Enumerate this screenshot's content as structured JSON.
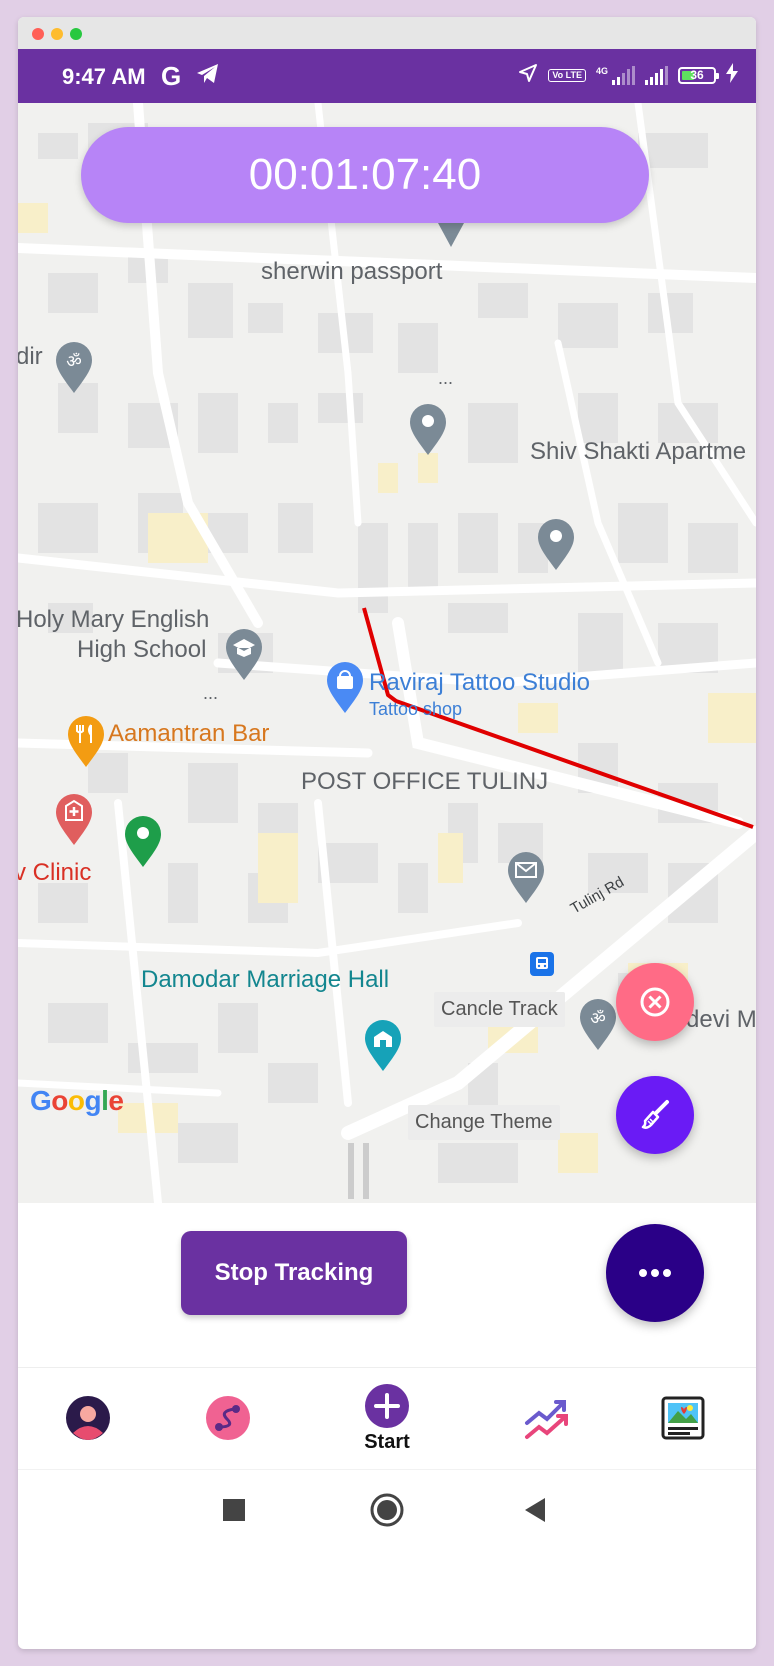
{
  "status_bar": {
    "time": "9:47 AM",
    "g_icon": "G",
    "network": "4G",
    "volte": "Vo LTE",
    "battery": "36"
  },
  "timer": {
    "value": "00:01:07:40"
  },
  "map": {
    "labels": {
      "sherwin": "sherwin passport",
      "dir": "dir",
      "dots1": "...",
      "shiv": "Shiv Shakti Apartme",
      "holy_line1": "Holy Mary English",
      "holy_line2": "High School",
      "dots2": "...",
      "raviraj": "Raviraj Tattoo Studio",
      "raviraj_sub": "Tattoo shop",
      "aamantran": "Aamantran Bar",
      "post_office": "POST OFFICE TULINJ",
      "clinic": "v Clinic",
      "tulinj_rd": "Tulinj Rd",
      "damodar": "Damodar Marriage Hall",
      "devi": "devi M"
    },
    "google": [
      "G",
      "o",
      "o",
      "g",
      "l",
      "e"
    ],
    "google_colors": [
      "#4285F4",
      "#EA4335",
      "#FBBC05",
      "#4285F4",
      "#34A853",
      "#EA4335"
    ]
  },
  "chips": {
    "cancel_track": "Cancle Track",
    "change_theme": "Change Theme"
  },
  "actions": {
    "stop_tracking": "Stop Tracking"
  },
  "bottom_nav": {
    "start_label": "Start",
    "icons": [
      "profile-avatar-icon",
      "route-icon",
      "start-plus-icon",
      "trend-chart-icon",
      "gallery-icon"
    ]
  },
  "colors": {
    "primary": "#6a31a1",
    "timer_bg": "#b784f7",
    "cancel_fab": "#ff6b86",
    "theme_fab": "#6a1bf5",
    "more_fab": "#2a0087",
    "route_line": "#e00000"
  }
}
